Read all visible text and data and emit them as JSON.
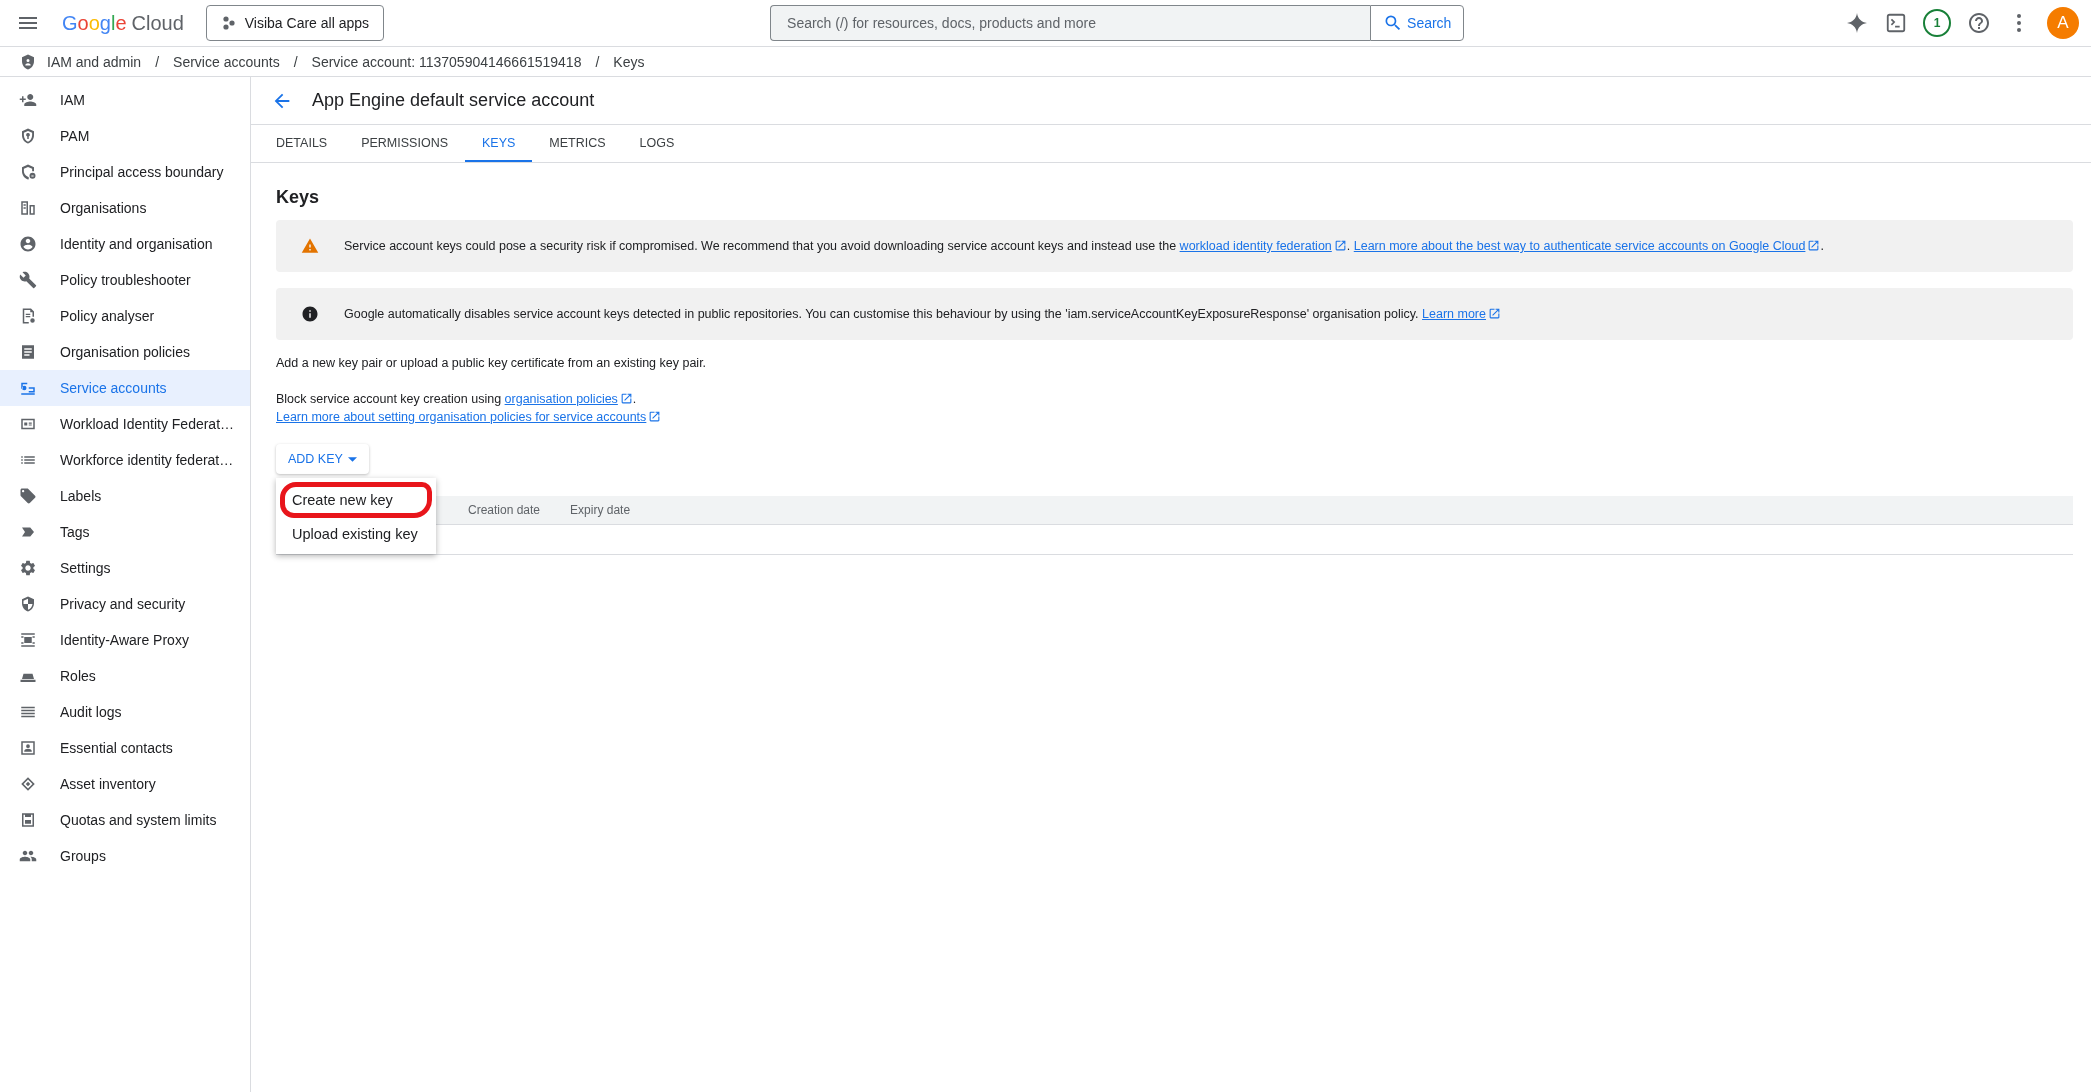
{
  "topbar": {
    "logo": {
      "brand": "Google",
      "product": "Cloud"
    },
    "project": "Visiba Care all apps",
    "search": {
      "placeholder": "Search (/) for resources, docs, products and more",
      "button": "Search"
    },
    "notifications": "1",
    "avatar": "A"
  },
  "breadcrumb_separator": "/",
  "breadcrumb": [
    "IAM and admin",
    "Service accounts",
    "Service account:  113705904146661519418",
    "Keys"
  ],
  "sidebar": {
    "items": [
      {
        "label": "IAM",
        "selected": false
      },
      {
        "label": "PAM",
        "selected": false
      },
      {
        "label": "Principal access boundary",
        "selected": false
      },
      {
        "label": "Organisations",
        "selected": false
      },
      {
        "label": "Identity and organisation",
        "selected": false
      },
      {
        "label": "Policy troubleshooter",
        "selected": false
      },
      {
        "label": "Policy analyser",
        "selected": false
      },
      {
        "label": "Organisation policies",
        "selected": false
      },
      {
        "label": "Service accounts",
        "selected": true
      },
      {
        "label": "Workload Identity Federat…",
        "selected": false
      },
      {
        "label": "Workforce identity federat…",
        "selected": false
      },
      {
        "label": "Labels",
        "selected": false
      },
      {
        "label": "Tags",
        "selected": false
      },
      {
        "label": "Settings",
        "selected": false
      },
      {
        "label": "Privacy and security",
        "selected": false
      },
      {
        "label": "Identity-Aware Proxy",
        "selected": false
      },
      {
        "label": "Roles",
        "selected": false
      },
      {
        "label": "Audit logs",
        "selected": false
      },
      {
        "label": "Essential contacts",
        "selected": false
      },
      {
        "label": "Asset inventory",
        "selected": false
      },
      {
        "label": "Quotas and system limits",
        "selected": false
      },
      {
        "label": "Groups",
        "selected": false
      }
    ]
  },
  "page": {
    "title": "App Engine default service account",
    "tabs": [
      {
        "label": "DETAILS",
        "selected": false
      },
      {
        "label": "PERMISSIONS",
        "selected": false
      },
      {
        "label": "KEYS",
        "selected": true
      },
      {
        "label": "METRICS",
        "selected": false
      },
      {
        "label": "LOGS",
        "selected": false
      }
    ],
    "heading": "Keys",
    "notices": [
      {
        "kind": "warning",
        "segments": [
          {
            "kind": "text",
            "text": "Service account keys could pose a security risk if compromised. We recommend that you avoid downloading service account keys and instead use the "
          },
          {
            "kind": "link",
            "text": "workload identity federation"
          },
          {
            "kind": "text",
            "text": ". "
          },
          {
            "kind": "link",
            "text": "Learn more about the best way to authenticate service accounts on Google Cloud"
          },
          {
            "kind": "text",
            "text": "."
          }
        ]
      },
      {
        "kind": "info",
        "segments": [
          {
            "kind": "text",
            "text": "Google automatically disables service account keys detected in public repositories. You can customise this behaviour by using the 'iam.serviceAccountKeyExposureResponse' organisation policy. "
          },
          {
            "kind": "link",
            "text": "Learn more"
          }
        ]
      }
    ],
    "intro": "Add a new key pair or upload a public key certificate from an existing key pair.",
    "block": [
      {
        "kind": "text",
        "text": "Block service account key creation using "
      },
      {
        "kind": "link",
        "text": "organisation policies"
      },
      {
        "kind": "text",
        "text": "."
      }
    ],
    "learn_link": "Learn more about setting organisation policies for service accounts",
    "add_key": "ADD KEY",
    "menu": [
      {
        "label": "Create new key",
        "highlighted": true
      },
      {
        "label": "Upload existing key",
        "highlighted": false
      }
    ],
    "table": {
      "columns": [
        "Creation date",
        "Expiry date"
      ]
    }
  }
}
